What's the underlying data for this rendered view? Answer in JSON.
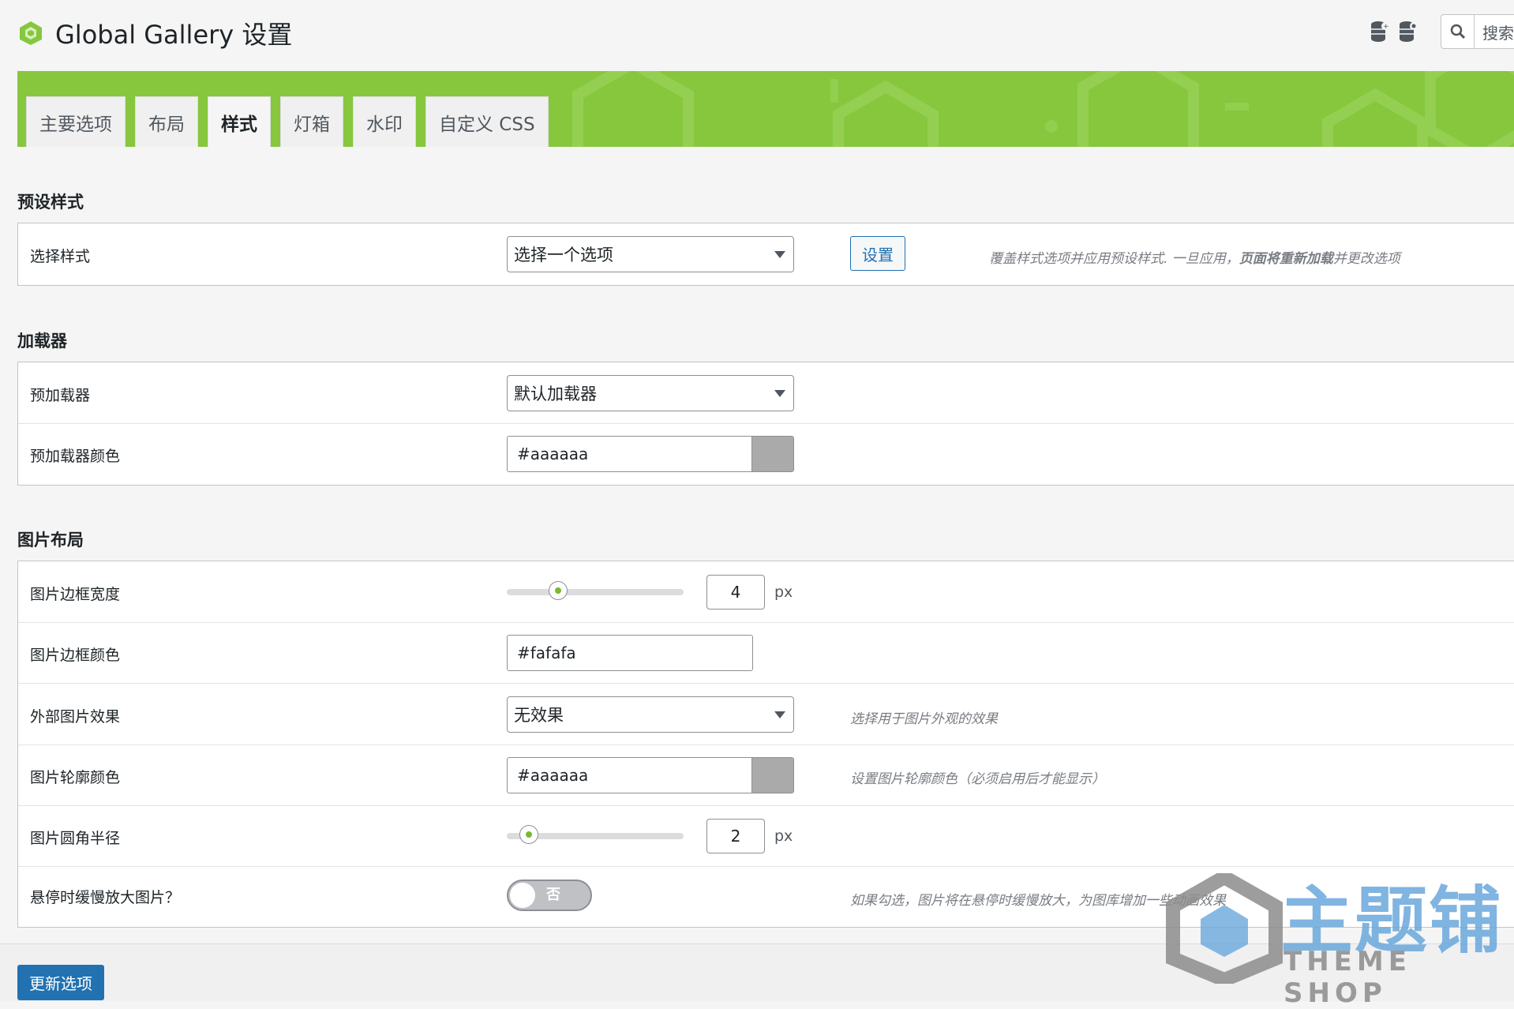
{
  "page": {
    "title": "Global Gallery 设置"
  },
  "search": {
    "button_label": "搜索"
  },
  "tabs": [
    {
      "label": "主要选项",
      "active": false
    },
    {
      "label": "布局",
      "active": false
    },
    {
      "label": "样式",
      "active": true
    },
    {
      "label": "灯箱",
      "active": false
    },
    {
      "label": "水印",
      "active": false
    },
    {
      "label": "自定义 CSS",
      "active": false
    }
  ],
  "colors": {
    "brand_green": "#86c73d",
    "primary_blue": "#2271b1",
    "swatch_grey": "#aaaaaa"
  },
  "sections": {
    "preset": {
      "title": "预设样式",
      "select_label": "选择样式",
      "select_value": "选择一个选项",
      "button_label": "设置",
      "desc_prefix": "覆盖样式选项并应用预设样式. 一旦应用，",
      "desc_strong": "页面将重新加载",
      "desc_suffix": "并更改选项"
    },
    "loader": {
      "title": "加载器",
      "preloader_label": "预加载器",
      "preloader_value": "默认加载器",
      "preloader_color_label": "预加载器颜色",
      "preloader_color_value": "#aaaaaa"
    },
    "image_layout": {
      "title": "图片布局",
      "border_width_label": "图片边框宽度",
      "border_width_value": "4",
      "border_width_unit": "px",
      "border_color_label": "图片边框颜色",
      "border_color_value": "#fafafa",
      "effect_label": "外部图片效果",
      "effect_value": "无效果",
      "effect_desc": "选择用于图片外观的效果",
      "outline_color_label": "图片轮廓颜色",
      "outline_color_value": "#aaaaaa",
      "outline_color_desc": "设置图片轮廓颜色（必须启用后才能显示）",
      "radius_label": "图片圆角半径",
      "radius_value": "2",
      "radius_unit": "px",
      "hover_zoom_label": "悬停时缓慢放大图片？",
      "hover_zoom_toggle": "否",
      "hover_zoom_desc": "如果勾选，图片将在悬停时缓慢放大，为图库增加一些动画效果"
    }
  },
  "footer": {
    "submit_label": "更新选项"
  },
  "watermark": {
    "title": "主题铺",
    "subtitle": "THEME SHOP"
  }
}
